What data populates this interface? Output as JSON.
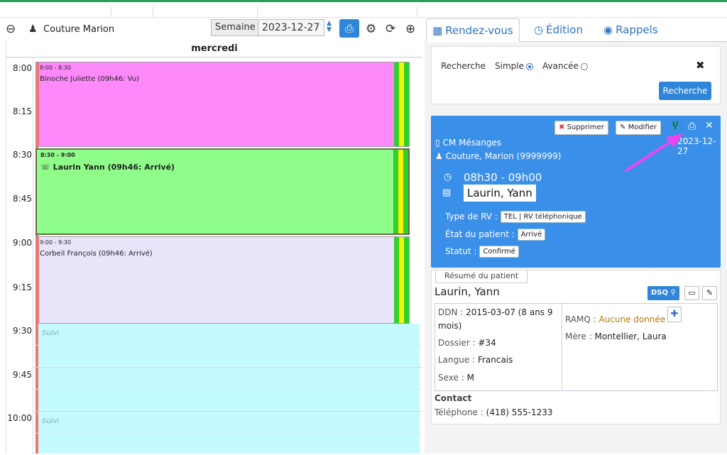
{
  "toolbar": {
    "provider": "Couture Marion",
    "view": "Semaine",
    "date": "2023-12-27"
  },
  "calendar": {
    "day_header": "mercredi",
    "times": [
      "8:00",
      "8:15",
      "8:30",
      "8:45",
      "9:00",
      "9:15",
      "9:30",
      "9:45",
      "10:00"
    ],
    "appointments": [
      {
        "when": "8:00 - 8:30",
        "who": "Binoche Juliette (09h46: Vu)",
        "color": "#fe89fb"
      },
      {
        "when": "8:30 - 9:00",
        "who": "☏ Laurin Yann (09h46: Arrivé)",
        "color": "#8ffd89"
      },
      {
        "when": "9:00 - 9:30",
        "who": "Corbeil François (09h46: Arrivé)",
        "color": "#e8e5fb"
      }
    ],
    "free_slot_label": "Suivi",
    "free_color": "#c4fbff"
  },
  "tabs": {
    "rendezvous": "Rendez-vous",
    "edition": "Édition",
    "rappels": "Rappels"
  },
  "search": {
    "label": "Recherche",
    "simple": "Simple",
    "advanced": "Avancée",
    "button": "Recherche"
  },
  "appointment_card": {
    "delete_label": "Supprimer",
    "modify_label": "Modifier",
    "clinic": "CM Mésanges",
    "provider": "Couture, Marion (9999999)",
    "date": "2023-12-27",
    "time": "08h30 - 09h00",
    "patient": "Laurin, Yann",
    "type_label": "Type de RV :",
    "type_value": "TEL | RV téléphonique",
    "state_label": "État du patient :",
    "state_value": "Arrivé",
    "status_label": "Statut :",
    "status_value": "Confirmé",
    "color": "#3a8fe8"
  },
  "summary": {
    "tab": "Résumé du patient",
    "name": "Laurin, Yann",
    "dsq": "DSQ",
    "ddn_label": "DDN :",
    "ddn_value": "2015-03-07 (8 ans 9 mois)",
    "dossier_label": "Dossier :",
    "dossier_value": "#34",
    "langue_label": "Langue :",
    "langue_value": "Francais",
    "sexe_label": "Sexe :",
    "sexe_value": "M",
    "ramq_label": "RAMQ :",
    "ramq_value": "Aucune donnée",
    "mere_label": "Mère :",
    "mere_value": "Montellier, Laura",
    "contact_label": "Contact",
    "phone_label": "Téléphone :",
    "phone_value": "(418) 555-1233"
  }
}
